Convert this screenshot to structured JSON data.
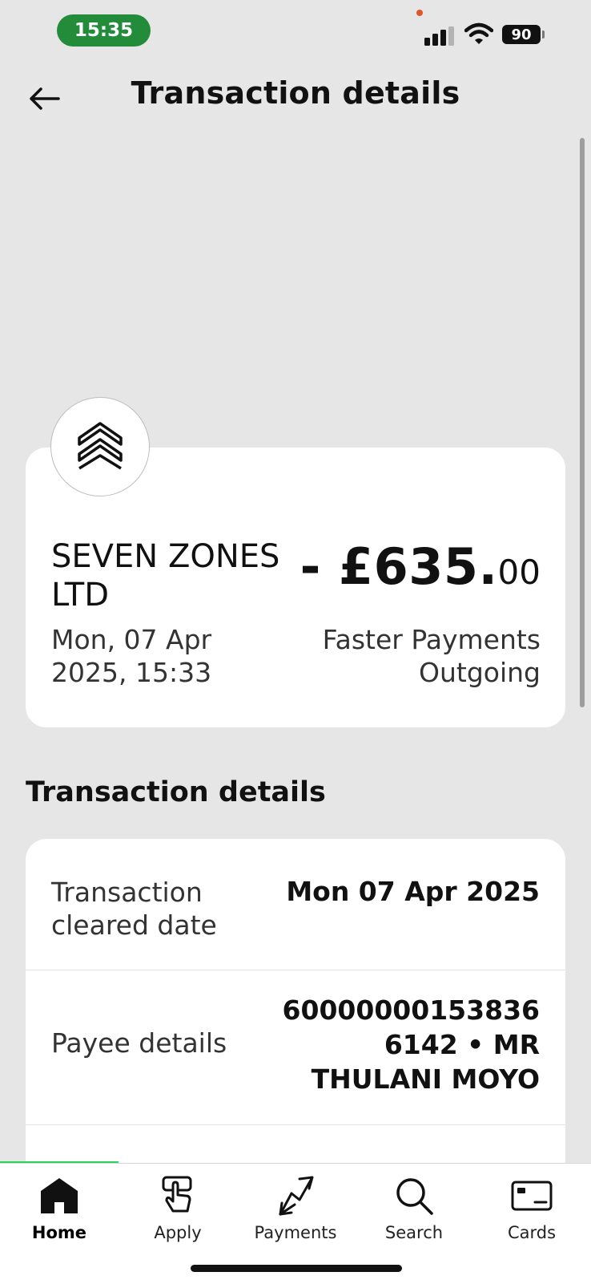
{
  "status_bar": {
    "time": "15:35",
    "battery": "90"
  },
  "header": {
    "title": "Transaction details"
  },
  "summary": {
    "merchant": "SEVEN ZONES LTD",
    "datetime": "Mon, 07 Apr 2025, 15:33",
    "amount_main": "- £635.",
    "amount_pence": "00",
    "payment_type": "Faster Payments Outgoing"
  },
  "details": {
    "heading": "Transaction details",
    "rows": [
      {
        "label": "Transaction cleared date",
        "value": "Mon 07 Apr 2025"
      },
      {
        "label": "Payee details",
        "value": "60000000153836 6142 • MR THULANI MOYO"
      }
    ]
  },
  "tabs": [
    {
      "label": "Home",
      "icon": "home-icon",
      "active": true
    },
    {
      "label": "Apply",
      "icon": "tap-hand-icon"
    },
    {
      "label": "Payments",
      "icon": "payments-arrows-icon"
    },
    {
      "label": "Search",
      "icon": "search-icon"
    },
    {
      "label": "Cards",
      "icon": "card-icon"
    }
  ],
  "colors": {
    "accent_green": "#238c3a",
    "tab_progress": "#2bd45a",
    "background": "#e6e6e6"
  }
}
